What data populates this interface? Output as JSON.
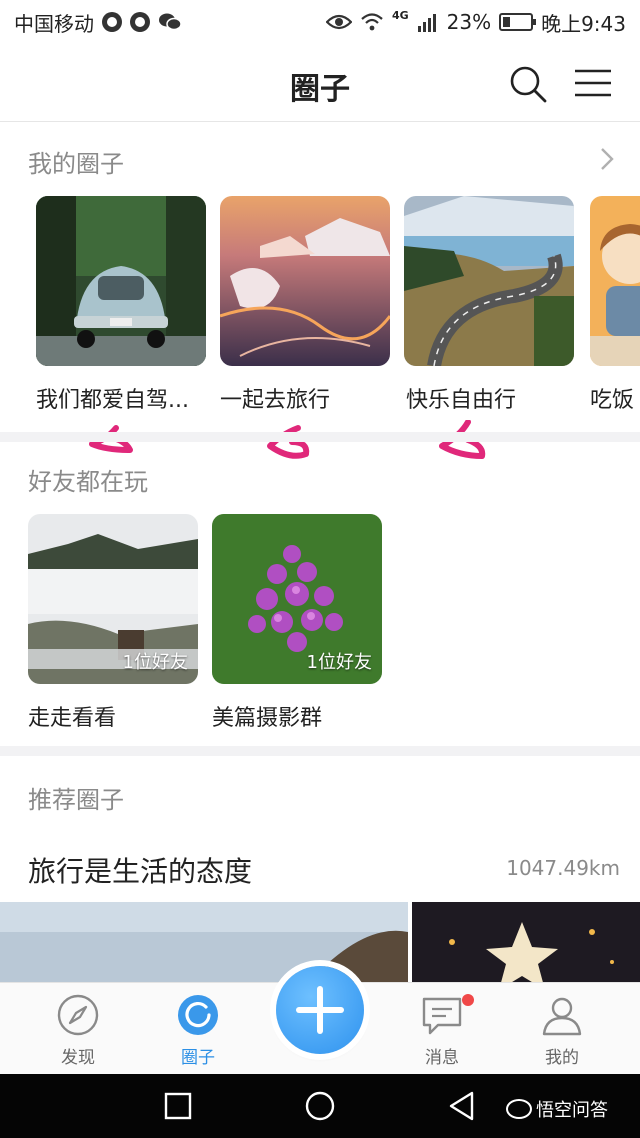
{
  "status_bar": {
    "carrier": "中国移动",
    "network": "4G",
    "battery": "23%",
    "time": "晚上9:43"
  },
  "header": {
    "title": "圈子"
  },
  "my_circles": {
    "title": "我的圈子",
    "items": [
      {
        "label": "我们都爱自驾..."
      },
      {
        "label": "一起去旅行"
      },
      {
        "label": "快乐自由行"
      },
      {
        "label": "吃饭"
      }
    ]
  },
  "friends": {
    "title": "好友都在玩",
    "items": [
      {
        "label": "走走看看",
        "badge": "1位好友"
      },
      {
        "label": "美篇摄影群",
        "badge": "1位好友"
      }
    ]
  },
  "recommended": {
    "title": "推荐圈子",
    "item": {
      "title": "旅行是生活的态度",
      "distance": "1047.49km"
    }
  },
  "tabbar": {
    "tabs": [
      {
        "label": "发现"
      },
      {
        "label": "圈子"
      },
      {
        "label": "消息"
      },
      {
        "label": "我的"
      }
    ]
  },
  "watermark": "悟空问答",
  "colors": {
    "accent": "#2b8fe5",
    "badge_red": "#f04848",
    "annotation_pink": "#e0287a"
  }
}
